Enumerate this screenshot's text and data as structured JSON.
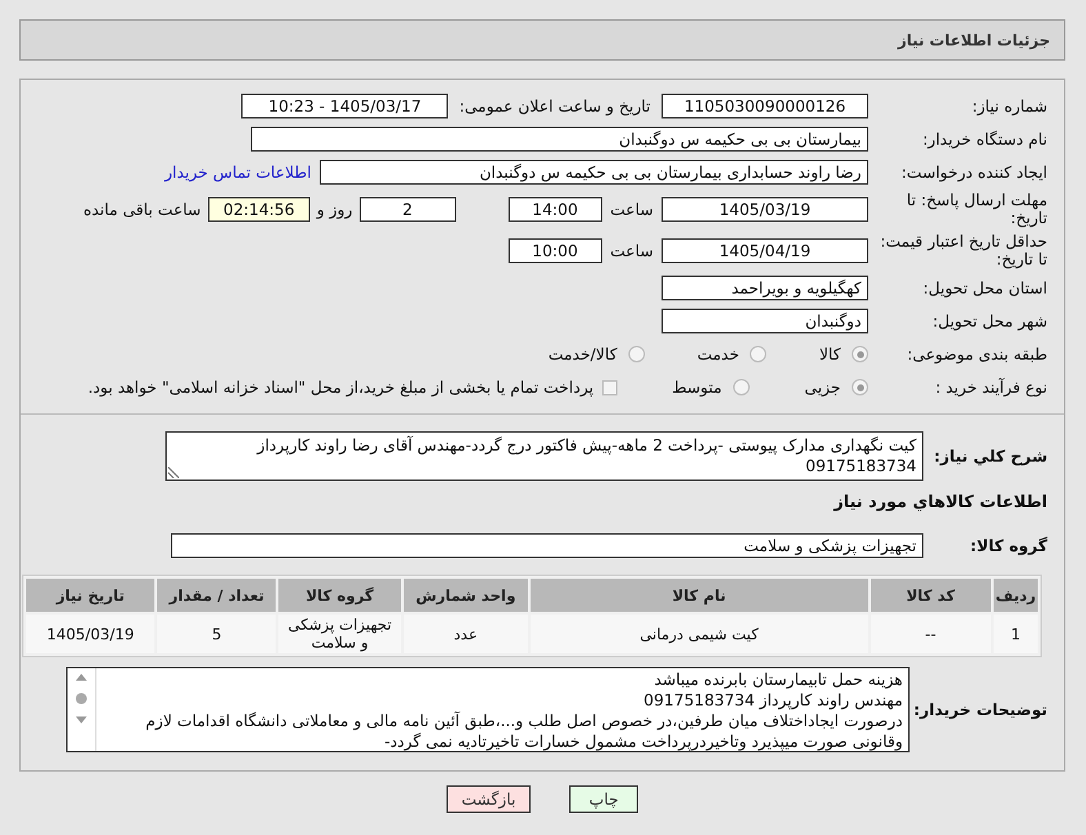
{
  "header": {
    "title": "جزئیات اطلاعات نیاز"
  },
  "need_number": {
    "label": "شماره نیاز:",
    "value": "1105030090000126"
  },
  "announce": {
    "label": "تاریخ و ساعت اعلان عمومی:",
    "value": "1405/03/17 - 10:23"
  },
  "buyer": {
    "label": "نام دستگاه خریدار:",
    "value": "بیمارستان بی بی حکیمه س  دوگنبدان"
  },
  "requester": {
    "label": "ایجاد کننده درخواست:",
    "value": "رضا راوند حسابداری بیمارستان بی بی حکیمه س  دوگنبدان",
    "link": "اطلاعات تماس خریدار"
  },
  "deadline": {
    "label": "مهلت ارسال پاسخ: تا تاریخ:",
    "date": "1405/03/19",
    "time_label": "ساعت",
    "time": "14:00",
    "days": "2",
    "days_label": "روز و",
    "remaining": "02:14:56",
    "remaining_label": "ساعت باقی مانده"
  },
  "validity": {
    "label": "حداقل تاریخ اعتبار قیمت: تا تاریخ:",
    "date": "1405/04/19",
    "time_label": "ساعت",
    "time": "10:00"
  },
  "province": {
    "label": "استان محل تحویل:",
    "value": "کهگیلویه و بویراحمد"
  },
  "city": {
    "label": "شهر محل تحویل:",
    "value": "دوگنبدان"
  },
  "category": {
    "label": "طبقه بندی موضوعی:",
    "options": [
      {
        "label": "کالا",
        "selected": true
      },
      {
        "label": "خدمت",
        "selected": false
      },
      {
        "label": "کالا/خدمت",
        "selected": false
      }
    ]
  },
  "process": {
    "label": "نوع فرآیند خرید :",
    "options": [
      {
        "label": "جزیی",
        "selected": true
      },
      {
        "label": "متوسط",
        "selected": false
      }
    ],
    "checkbox": {
      "label": "پرداخت تمام یا بخشی از مبلغ خرید،از محل \"اسناد خزانه اسلامی\" خواهد بود.",
      "checked": false
    }
  },
  "description": {
    "label": "شرح کلي نیاز:",
    "value": "کیت نگهداری مدارک پیوستی  -پرداخت 2 ماهه-پیش فاکتور درج گردد-مهندس آقای رضا راوند کارپرداز 09175183734"
  },
  "goods_heading": "اطلاعات کالاهاي مورد نیاز",
  "goods_group": {
    "label": "گروه کالا:",
    "value": "تجهیزات پزشکی و سلامت"
  },
  "table": {
    "columns": [
      "ردیف",
      "کد کالا",
      "نام کالا",
      "واحد شمارش",
      "گروه کالا",
      "تعداد / مقدار",
      "تاریخ نیاز"
    ],
    "rows": [
      [
        "1",
        "--",
        "کیت شیمی درمانی",
        "عدد",
        "تجهیزات پزشکی و سلامت",
        "5",
        "1405/03/19"
      ]
    ]
  },
  "buyer_notes": {
    "label": "توضیحات خریدار:",
    "lines": [
      "هزینه حمل تابیمارستان بابرنده میباشد",
      "مهندس  راوند کارپرداز  09175183734",
      "درصورت ایجاداختلاف میان طرفین،در خصوص اصل طلب و...،طبق آئین نامه مالی و معاملاتی دانشگاه اقدامات لازم وقانونی صورت میپذیرد وتاخیردرپرداخت مشمول خسارات تاخیرتادیه نمی گردد-"
    ]
  },
  "buttons": [
    {
      "label": "چاپ",
      "kind": "print"
    },
    {
      "label": "بازگشت",
      "kind": "back"
    }
  ]
}
